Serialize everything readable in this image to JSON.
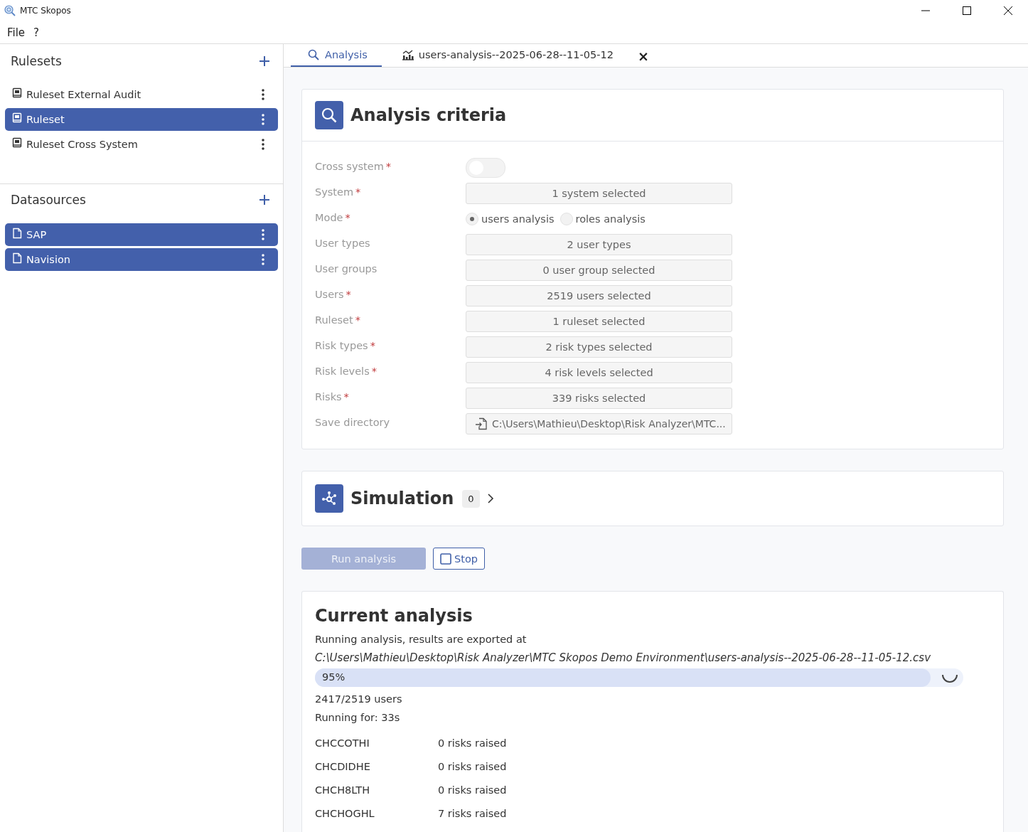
{
  "window": {
    "title": "MTC Skopos"
  },
  "menu": [
    "File",
    "?"
  ],
  "sidebar": {
    "sections": [
      {
        "title": "Rulesets",
        "kind": "ruleset",
        "items": [
          {
            "label": "Ruleset External Audit",
            "selected": false
          },
          {
            "label": "Ruleset",
            "selected": true
          },
          {
            "label": "Ruleset Cross System",
            "selected": false
          }
        ]
      },
      {
        "title": "Datasources",
        "kind": "datasource",
        "items": [
          {
            "label": "SAP",
            "selected": true
          },
          {
            "label": "Navision",
            "selected": true
          }
        ]
      }
    ]
  },
  "tabs": [
    {
      "label": "Analysis",
      "kind": "search",
      "selected": true
    },
    {
      "label": "users-analysis--2025-06-28--11-05-12",
      "kind": "chart",
      "selected": false,
      "close": "×"
    }
  ],
  "criteria": {
    "title": "Analysis criteria",
    "fields": [
      {
        "label": "Cross system",
        "required": "*",
        "kind": "toggle",
        "on": false
      },
      {
        "label": "System",
        "required": "*",
        "kind": "select",
        "value": "1 system selected"
      },
      {
        "label": "Mode",
        "required": "*",
        "kind": "radio",
        "options": [
          {
            "label": "users analysis",
            "selected": true
          },
          {
            "label": "roles analysis",
            "selected": false
          }
        ]
      },
      {
        "label": "User types",
        "kind": "select",
        "value": "2 user types"
      },
      {
        "label": "User groups",
        "kind": "select",
        "value": "0 user group selected"
      },
      {
        "label": "Users",
        "required": "*",
        "kind": "select",
        "value": "2519 users selected"
      },
      {
        "label": "Ruleset",
        "required": "*",
        "kind": "select",
        "value": "1 ruleset selected"
      },
      {
        "label": "Risk types",
        "required": "*",
        "kind": "select",
        "value": "2 risk types selected"
      },
      {
        "label": "Risk levels",
        "required": "*",
        "kind": "select",
        "value": "4 risk levels selected"
      },
      {
        "label": "Risks",
        "required": "*",
        "kind": "select",
        "value": "339 risks selected"
      },
      {
        "label": "Save directory",
        "kind": "path",
        "value": "C:\\Users\\Mathieu\\Desktop\\Risk Analyzer\\MTC..."
      }
    ]
  },
  "simulation": {
    "title": "Simulation",
    "count": "0",
    "expanded": false
  },
  "buttons": [
    {
      "label": "Run analysis",
      "kind": "primary",
      "disabled": true
    },
    {
      "label": "Stop",
      "kind": "stop",
      "disabled": false
    }
  ],
  "current": {
    "title": "Current analysis",
    "message": "Running analysis, results are exported at",
    "path": "C:\\Users\\Mathieu\\Desktop\\Risk Analyzer\\MTC Skopos Demo Environment\\users-analysis--2025-06-28--11-05-12.csv",
    "progress": {
      "level": 0.95,
      "label": "95%"
    },
    "count": "2417/2519 users",
    "elapsed": "Running for: 33s",
    "results": [
      {
        "user": "CHCCOTHI",
        "risks": "0 risks raised"
      },
      {
        "user": "CHCDIDHE",
        "risks": "0 risks raised"
      },
      {
        "user": "CHCH8LTH",
        "risks": "0 risks raised"
      },
      {
        "user": "CHCHOGHL",
        "risks": "7 risks raised"
      }
    ]
  }
}
